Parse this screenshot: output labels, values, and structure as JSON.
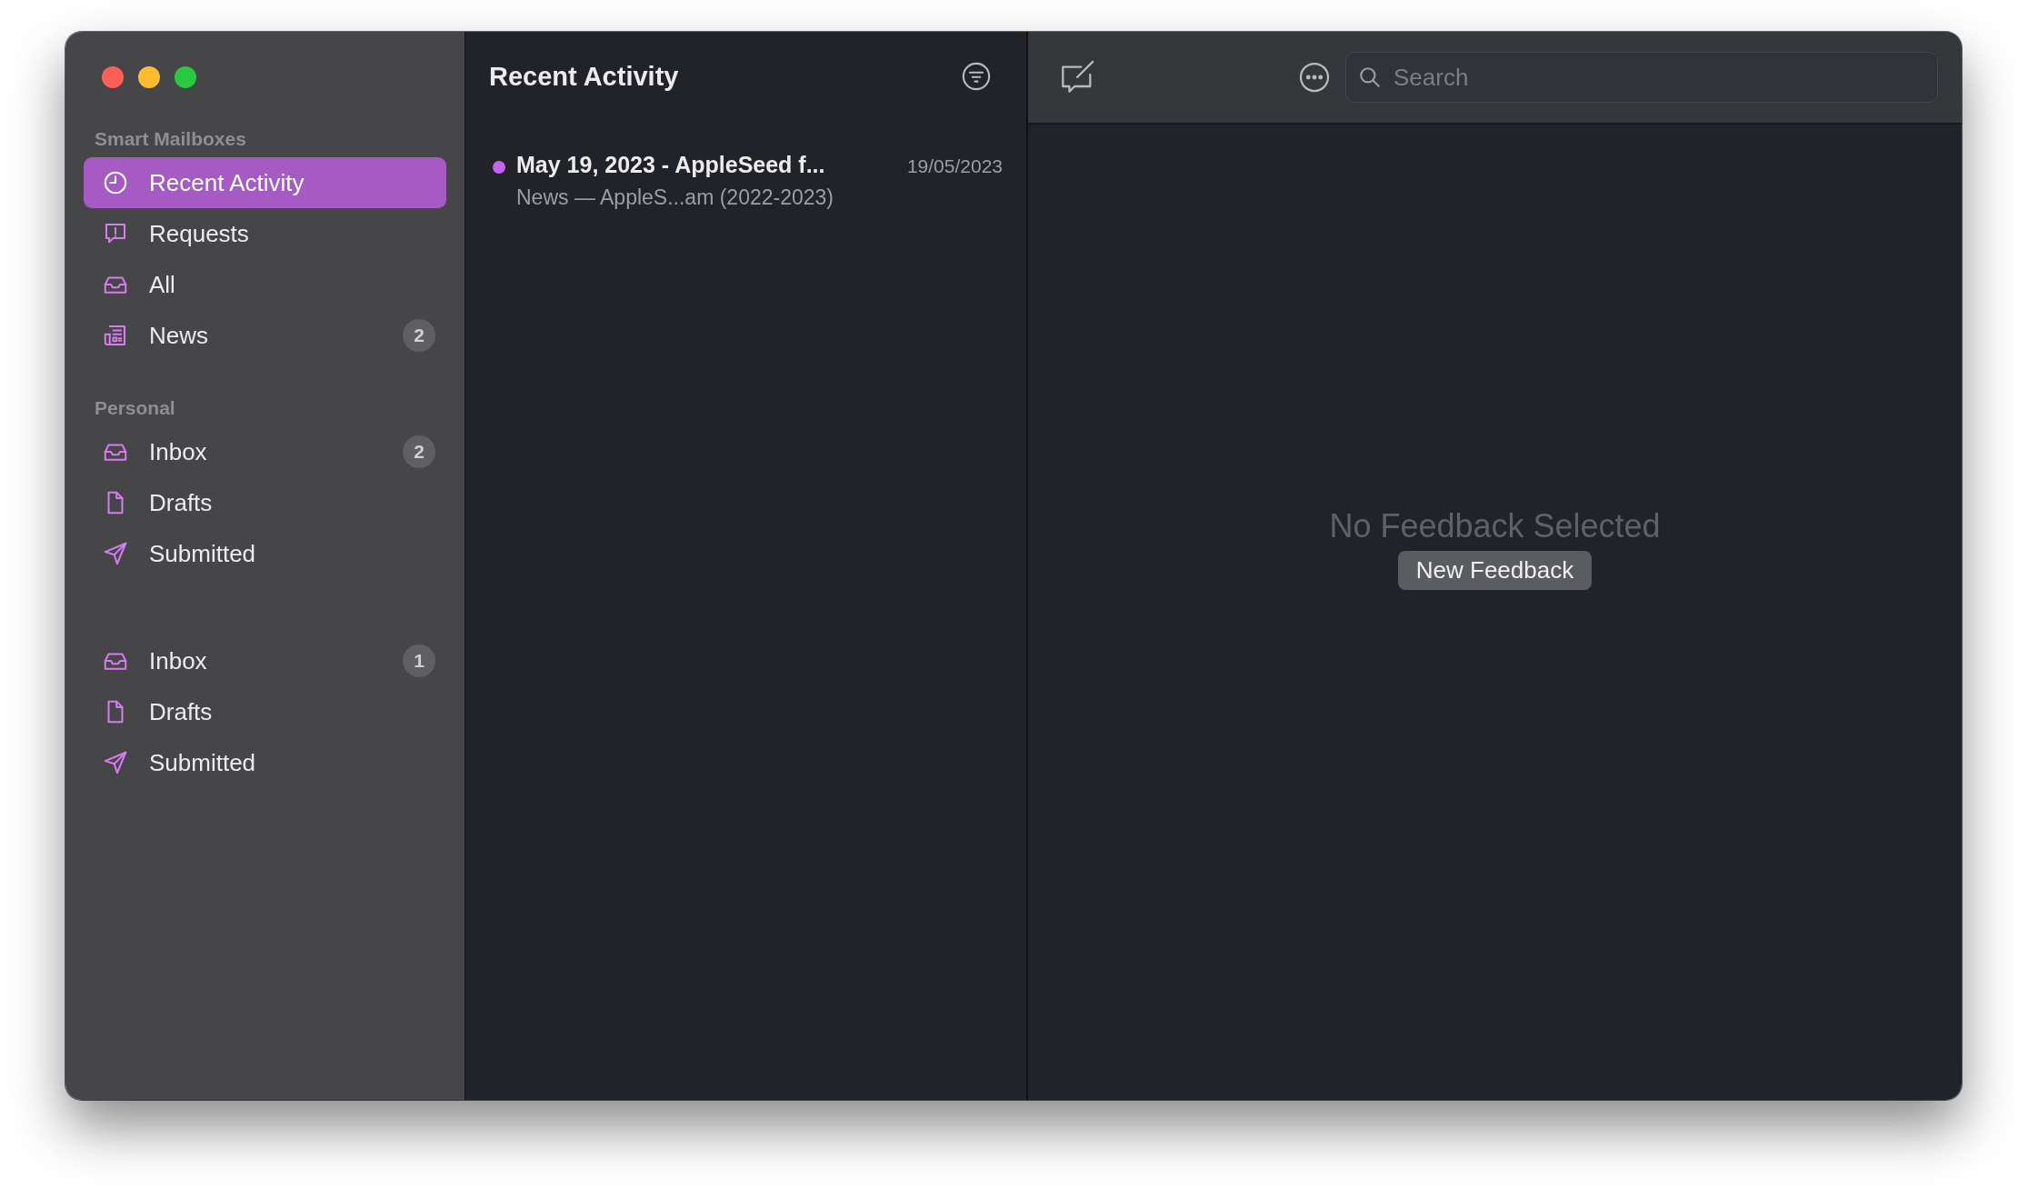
{
  "sidebar": {
    "sections": [
      {
        "heading": "Smart Mailboxes",
        "items": [
          {
            "kind": "clock",
            "label": "Recent Activity",
            "selected": true
          },
          {
            "kind": "request",
            "label": "Requests",
            "selected": false
          },
          {
            "kind": "tray",
            "label": "All",
            "selected": false
          },
          {
            "kind": "newspaper",
            "label": "News",
            "badge": "2",
            "selected": false
          }
        ]
      },
      {
        "heading": "Personal",
        "items": [
          {
            "kind": "tray",
            "label": "Inbox",
            "badge": "2",
            "selected": false
          },
          {
            "kind": "document",
            "label": "Drafts",
            "selected": false
          },
          {
            "kind": "send",
            "label": "Submitted",
            "selected": false
          }
        ]
      },
      {
        "items": [
          {
            "kind": "tray",
            "label": "Inbox",
            "badge": "1",
            "selected": false
          },
          {
            "kind": "document",
            "label": "Drafts",
            "selected": false
          },
          {
            "kind": "send",
            "label": "Submitted",
            "selected": false
          }
        ]
      }
    ]
  },
  "list": {
    "title": "Recent Activity",
    "items": [
      {
        "title": "May 19, 2023 - AppleSeed f...",
        "date": "19/05/2023",
        "subtitle": "News — AppleS...am (2022-2023)",
        "unread": true
      }
    ]
  },
  "toolbar": {
    "search": {
      "placeholder": "Search"
    }
  },
  "detail": {
    "empty_text": "No Feedback Selected",
    "button": "New Feedback"
  }
}
